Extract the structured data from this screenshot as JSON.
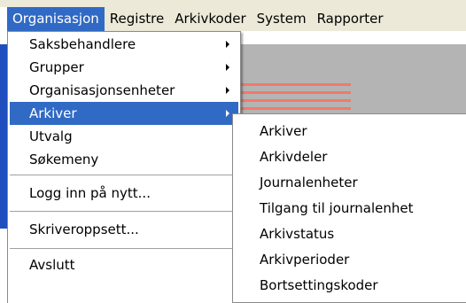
{
  "menubar": {
    "items": [
      {
        "label": "Organisasjon"
      },
      {
        "label": "Registre"
      },
      {
        "label": "Arkivkoder"
      },
      {
        "label": "System"
      },
      {
        "label": "Rapporter"
      }
    ]
  },
  "organisasjon_menu": {
    "items": [
      {
        "label": "Saksbehandlere"
      },
      {
        "label": "Grupper"
      },
      {
        "label": "Organisasjonsenheter"
      },
      {
        "label": "Arkiver"
      },
      {
        "label": "Utvalg"
      },
      {
        "label": "Søkemeny"
      },
      {
        "label": "Logg inn på nytt..."
      },
      {
        "label": "Skriveroppsett..."
      },
      {
        "label": "Avslutt"
      }
    ]
  },
  "arkiver_submenu": {
    "items": [
      {
        "label": "Arkiver"
      },
      {
        "label": "Arkivdeler"
      },
      {
        "label": "Journalenheter"
      },
      {
        "label": "Tilgang til journalenhet"
      },
      {
        "label": "Arkivstatus"
      },
      {
        "label": "Arkivperioder"
      },
      {
        "label": "Bortsettingskoder"
      }
    ]
  },
  "colors": {
    "highlight": "#316ac5",
    "menubar_bg": "#ece9d8",
    "background_blue": "#1f4fbf",
    "background_gray": "#b4b4b4",
    "logo_stripe": "#f2796a"
  }
}
